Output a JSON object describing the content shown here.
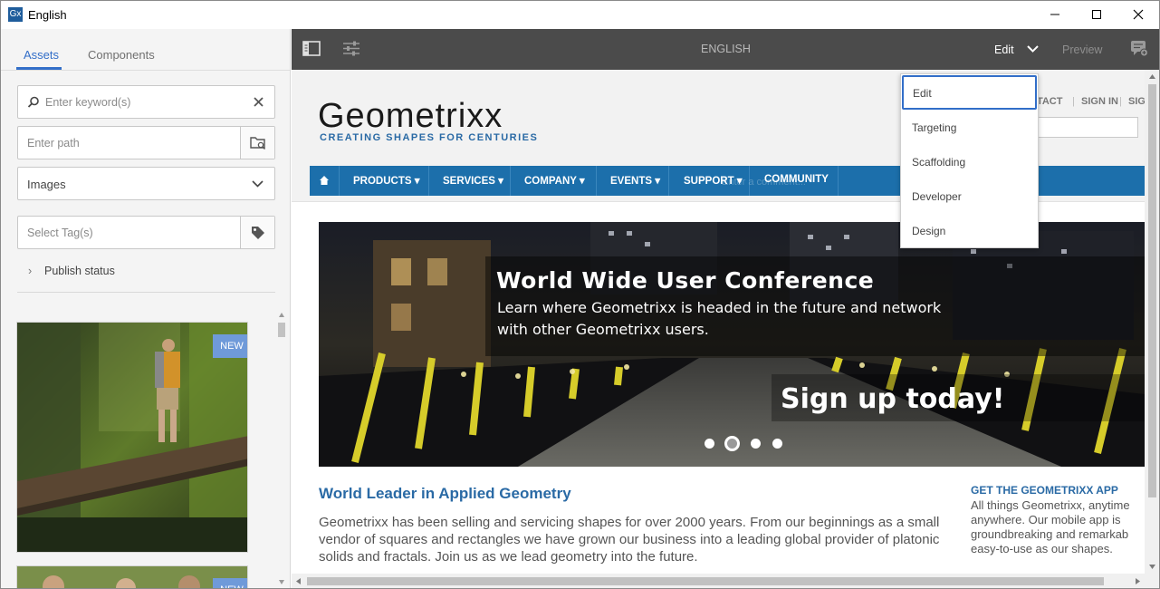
{
  "window": {
    "title": "English",
    "app_icon": "Gx",
    "controls": [
      "minimize-icon",
      "maximize-icon",
      "close-icon"
    ]
  },
  "left_panel": {
    "tabs": [
      {
        "label": "Assets",
        "active": true
      },
      {
        "label": "Components",
        "active": false
      }
    ],
    "keyword_search": {
      "placeholder": "Enter keyword(s)",
      "value": ""
    },
    "path_field": {
      "placeholder": "Enter path",
      "value": ""
    },
    "type_select": {
      "selected": "Images"
    },
    "tag_field": {
      "placeholder": "Select Tag(s)",
      "value": ""
    },
    "publish_status": "Publish status",
    "assets": [
      {
        "badge": "NEW",
        "description": "hiker crossing log in mossy canyon"
      },
      {
        "badge": "NEW",
        "description": "people outdoors"
      }
    ]
  },
  "toolbar": {
    "page_title": "ENGLISH",
    "mode_label": "Edit",
    "preview_label": "Preview",
    "icons": [
      "sidebar-toggle-icon",
      "page-properties-icon",
      "annotations-icon"
    ]
  },
  "mode_menu": {
    "items": [
      "Edit",
      "Targeting",
      "Scaffolding",
      "Developer",
      "Design"
    ],
    "selected": "Edit"
  },
  "site": {
    "logo": "Geometrixx",
    "tagline": "CREATING SHAPES FOR CENTURIES",
    "top_links": [
      "NTACT",
      "SIGN IN",
      "SIG"
    ],
    "nav": [
      "PRODUCTS",
      "SERVICES",
      "COMPANY",
      "EVENTS",
      "SUPPORT",
      "COMMUNITY"
    ],
    "nav_has_caret": [
      true,
      true,
      true,
      true,
      true,
      false
    ],
    "nav_overlap_text": "Enter a comment...",
    "hero": {
      "title": "World Wide User Conference",
      "subtitle": "Learn where Geometrixx is headed in the future and network with other Geometrixx users.",
      "cta": "Sign up today!",
      "slides": 4,
      "active_slide": 2
    },
    "headline": "World Leader in Applied Geometry",
    "body": "Geometrixx has been selling and servicing shapes for over 2000 years. From our beginnings as a small vendor of squares and rectangles we have grown our business into a leading global provider of platonic solids and fractals. Join us as we lead geometry into the future.",
    "side_title": "GET THE GEOMETRIXX APP",
    "side_text": [
      "All things Geometrixx, anytime",
      "anywhere. Our mobile app is",
      "groundbreaking and remarkab",
      "easy-to-use as our shapes."
    ]
  },
  "colors": {
    "accent": "#326ec8",
    "toolbar_bg": "#4b4b4b",
    "site_blue": "#2a6aa5",
    "nav_blue": "#1c6fab",
    "badge_blue": "#6f9ad9"
  }
}
